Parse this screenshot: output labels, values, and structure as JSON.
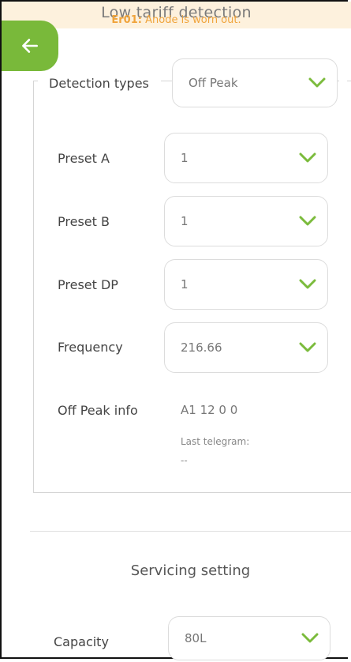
{
  "header": {
    "title": "Low tariff detection",
    "error_code": "Er01:",
    "error_message": "Anode is worn out."
  },
  "detection": {
    "label": "Detection types",
    "value": "Off Peak"
  },
  "presets": {
    "preset_a_label": "Preset A",
    "preset_a_value": "1",
    "preset_b_label": "Preset B",
    "preset_b_value": "1",
    "preset_dp_label": "Preset DP",
    "preset_dp_value": "1",
    "frequency_label": "Frequency",
    "frequency_value": "216.66"
  },
  "offpeak": {
    "label": "Off Peak info",
    "value": "A1 12 0 0",
    "last_telegram_label": "Last telegram:",
    "last_telegram_value": "--"
  },
  "servicing": {
    "title": "Servicing setting",
    "capacity_label": "Capacity",
    "capacity_value": "80L"
  },
  "colors": {
    "accent": "#79b93a",
    "warning": "#f0a43b",
    "topbar": "#fdf1dd"
  },
  "icons": {
    "back": "arrow-left-icon",
    "dropdown": "chevron-down-icon"
  }
}
